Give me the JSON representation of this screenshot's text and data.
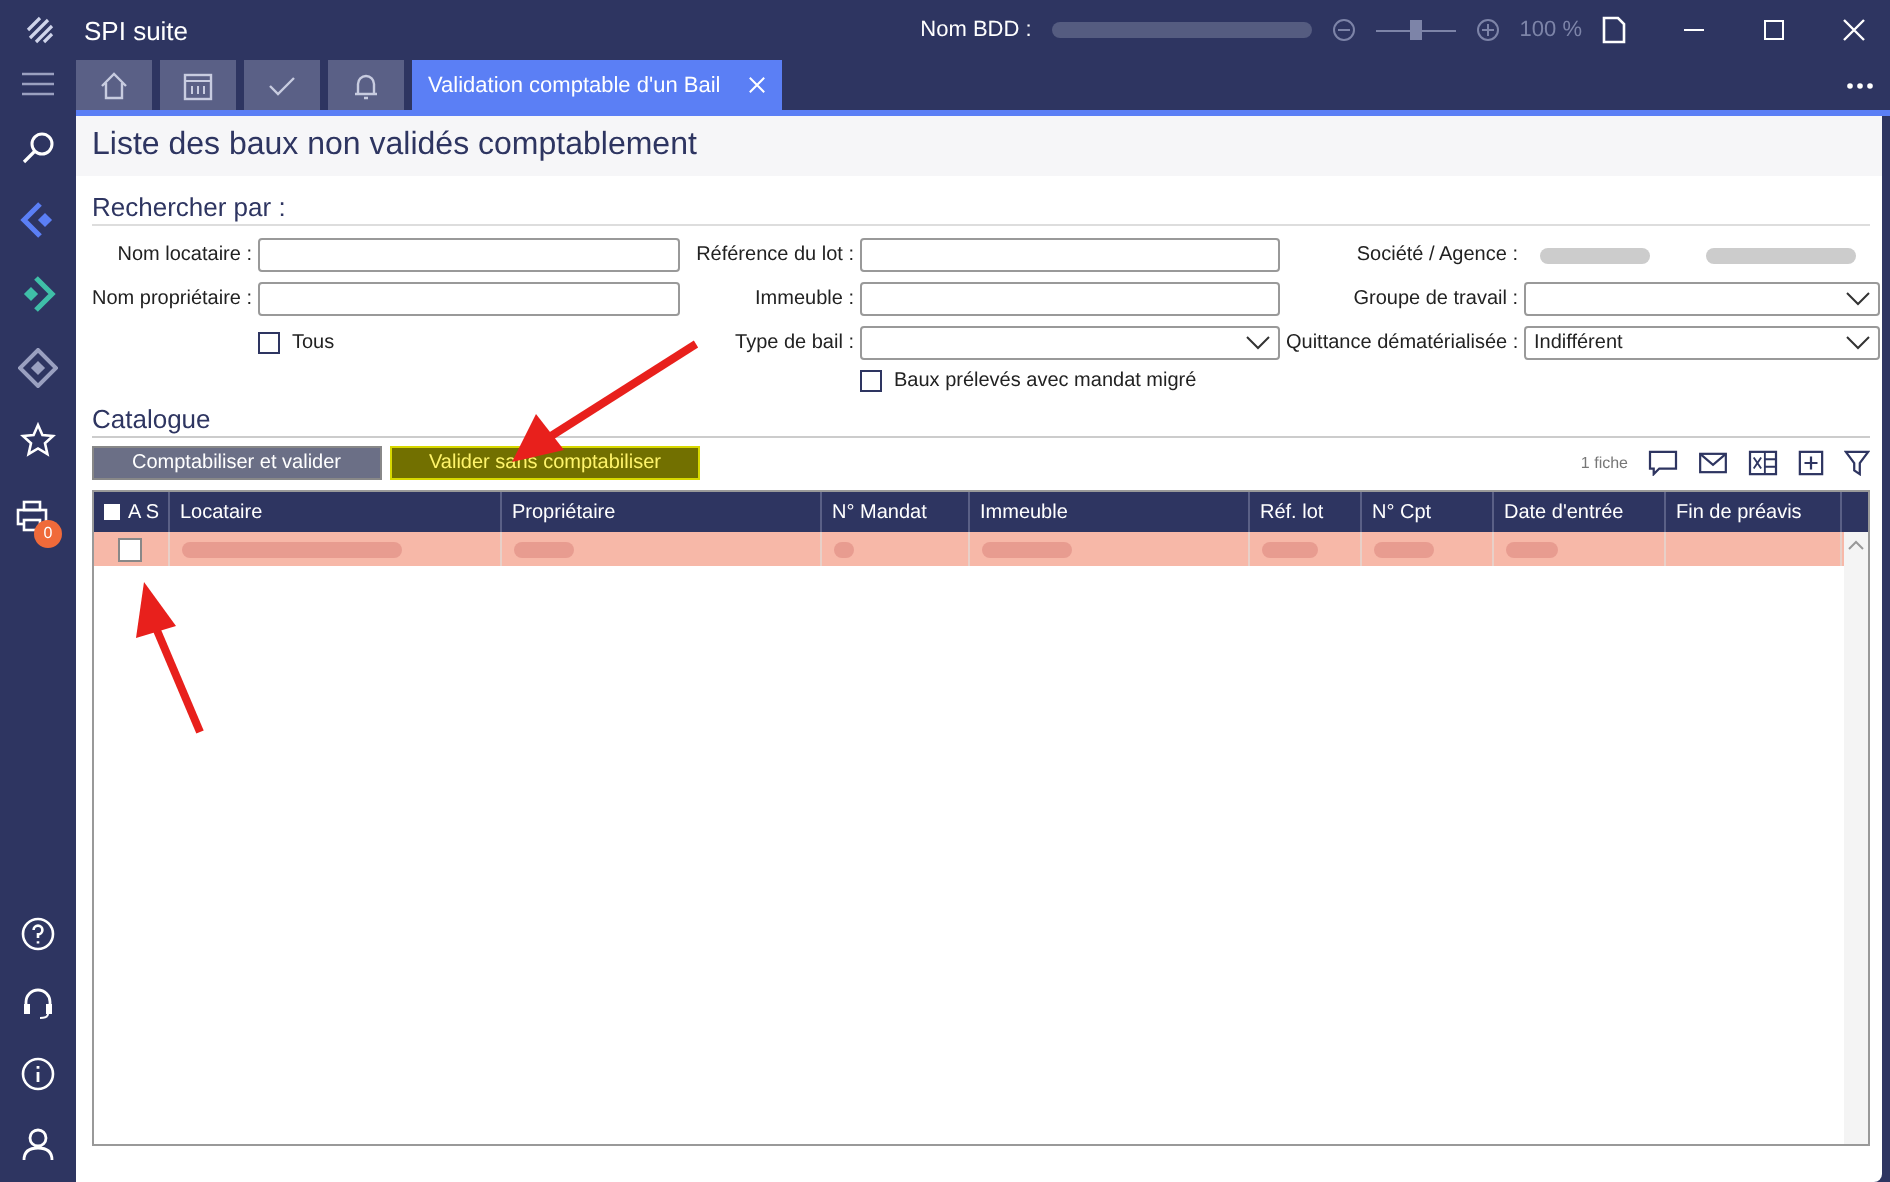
{
  "window": {
    "title": "SPI suite",
    "db_label": "Nom BDD :",
    "zoom": {
      "level": 0.5,
      "reading": "100 %"
    }
  },
  "tabs": [
    {
      "kind": "home",
      "selected": false
    },
    {
      "kind": "calendar",
      "selected": false
    },
    {
      "kind": "check",
      "selected": false
    },
    {
      "kind": "bell",
      "selected": false
    },
    {
      "kind": "text",
      "label": "Validation comptable d'un Bail",
      "selected": true
    }
  ],
  "sidebar": {
    "badge": "0"
  },
  "page": {
    "title": "Liste des baux non validés comptablement"
  },
  "search": {
    "heading": "Rechercher par :",
    "fields": [
      {
        "kind": "text",
        "label": "Nom locataire :"
      },
      {
        "kind": "text",
        "label": "Référence du lot :"
      },
      {
        "kind": "static",
        "label": "Société / Agence :"
      },
      {
        "kind": "text",
        "label": "Nom propriétaire :"
      },
      {
        "kind": "text",
        "label": "Immeuble :"
      },
      {
        "kind": "select",
        "label": "Groupe de travail :"
      },
      {
        "kind": "checkbox",
        "label": "Tous",
        "checked": false
      },
      {
        "kind": "select",
        "label": "Type de bail :"
      },
      {
        "kind": "select",
        "label": "Quittance dématérialisée :",
        "value": "Indifférent"
      },
      {
        "kind": "empty"
      },
      {
        "kind": "checkbox",
        "label": "Baux prélevés avec mandat migré",
        "checked": false
      }
    ]
  },
  "catalogue": {
    "heading": "Catalogue",
    "buttons": [
      {
        "label": "Comptabiliser et valider",
        "kind": "gray"
      },
      {
        "label": "Valider sans comptabiliser",
        "kind": "yellow"
      }
    ],
    "count": "1 fiche"
  },
  "table": {
    "select_all": false,
    "columns": [
      "A S",
      "Locataire",
      "Propriétaire",
      "N° Mandat",
      "Immeuble",
      "Réf. lot",
      "N° Cpt",
      "Date d'entrée",
      "Fin de préavis"
    ],
    "rows": [
      {
        "checked": false,
        "highlighted": true
      }
    ]
  }
}
